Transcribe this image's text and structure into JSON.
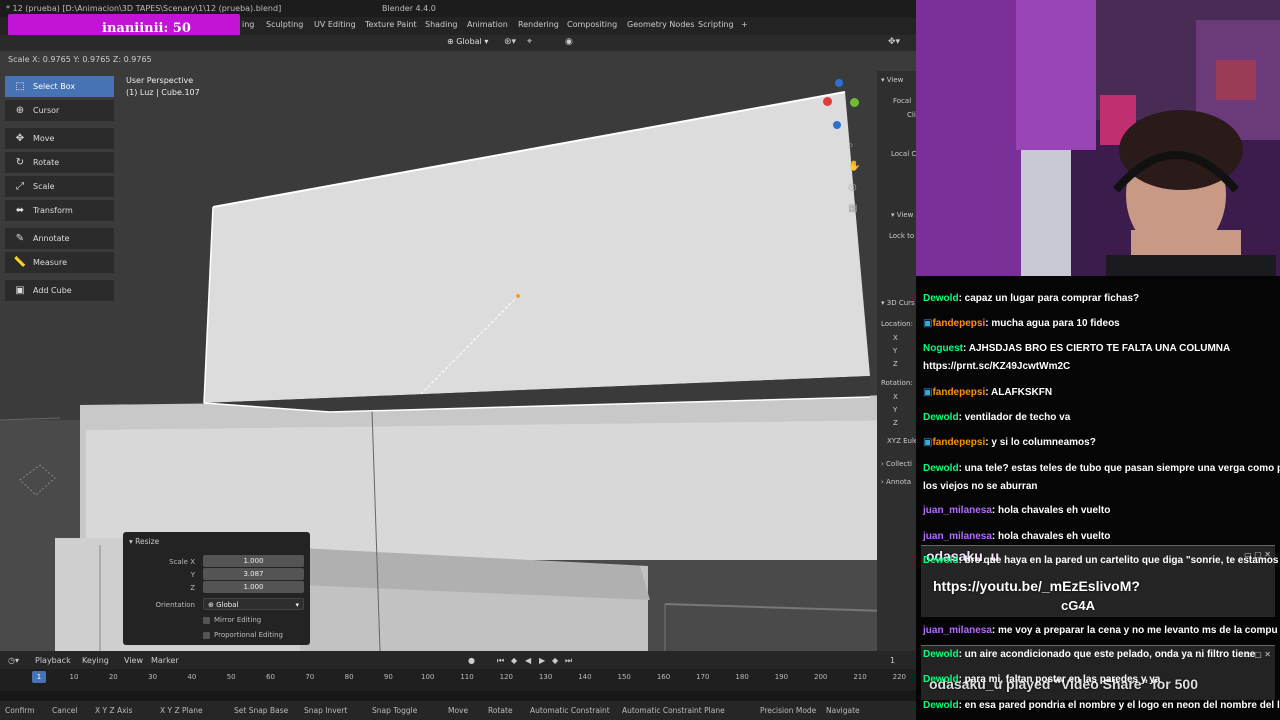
{
  "window": {
    "title": "* 12 (prueba) [D:\\Animacion\\3D TAPES\\Scenary\\1\\12 (prueba).blend]",
    "app_title": "Blender 4.4.0"
  },
  "alert": {
    "text": "inaniinii: 50"
  },
  "workspaces": [
    "ing",
    "Sculpting",
    "UV Editing",
    "Texture Paint",
    "Shading",
    "Animation",
    "Rendering",
    "Compositing",
    "Geometry Nodes",
    "Scripting",
    "+"
  ],
  "header": {
    "orientation": "Global"
  },
  "scale_info": "Scale X: 0.9765   Y: 0.9765   Z: 0.9765",
  "viewport": {
    "perspective": "User Perspective",
    "collection": "(1) Luz  | Cube.107"
  },
  "tools": [
    "Select Box",
    "Cursor",
    "Move",
    "Rotate",
    "Scale",
    "Transform",
    "Annotate",
    "Measure",
    "Add Cube"
  ],
  "resize_panel": {
    "title": "Resize",
    "scale_x_label": "Scale X",
    "scale_x": "1.000",
    "y_label": "Y",
    "y": "3.087",
    "z_label": "Z",
    "z": "1.000",
    "orientation_label": "Orientation",
    "orientation": "Global",
    "mirror_editing": "Mirror Editing",
    "proportional_editing": "Proportional Editing"
  },
  "n_panel": {
    "view": "View",
    "focal": "Focal",
    "clip": "Cli",
    "local": "Local C",
    "view2": "View",
    "lock": "Lock to",
    "cursor": "3D Curs",
    "location": "Location:",
    "x": "X",
    "y": "Y",
    "z": "Z",
    "rotation": "Rotation:",
    "euler": "XYZ Eule",
    "collection": "Collecti",
    "annotations": "Annota"
  },
  "timeline": {
    "menus": [
      "Playback",
      "Keying",
      "View",
      "Marker"
    ],
    "current_frame": "1",
    "frame_field": "1",
    "ticks": [
      "10",
      "20",
      "30",
      "40",
      "50",
      "60",
      "70",
      "80",
      "90",
      "100",
      "110",
      "120",
      "130",
      "140",
      "150",
      "160",
      "170",
      "180",
      "190",
      "200",
      "210",
      "220"
    ]
  },
  "statusbar": [
    "Confirm",
    "Cancel",
    "X Y Z Axis",
    "X Y Z Plane",
    "Set Snap Base",
    "Snap Invert",
    "Snap Toggle",
    "Move",
    "Rotate",
    "Automatic Constraint",
    "Automatic Constraint Plane",
    "Precision Mode",
    "Navigate"
  ],
  "chat": [
    {
      "user": "Dewold",
      "color": "#00ff7f",
      "msg": ": capaz un lugar para comprar fichas?"
    },
    {
      "user": "fandepepsi",
      "color": "#ff9100",
      "msg": ": mucha agua para 10 fideos"
    },
    {
      "user": "Noguest",
      "color": "#00ff7f",
      "msg": ": AJHSDJAS BRO ES CIERTO TE FALTA UNA COLUMNA"
    },
    {
      "user": "",
      "color": "#ffffff",
      "msg": "https://prnt.sc/KZ49JcwtWm2C"
    },
    {
      "user": "fandepepsi",
      "color": "#ff9100",
      "msg": ": ALAFKSKFN"
    },
    {
      "user": "Dewold",
      "color": "#00ff7f",
      "msg": ": ventilador de techo va"
    },
    {
      "user": "fandepepsi",
      "color": "#ff9100",
      "msg": ": y si lo columneamos?"
    },
    {
      "user": "Dewold",
      "color": "#00ff7f",
      "msg": ": una tele? estas teles de tubo que pasan siempre una verga como para que"
    },
    {
      "user": "",
      "color": "#ffffff",
      "msg": "los viejos no se aburran"
    },
    {
      "user": "juan_milanesa",
      "color": "#b36bff",
      "msg": ": hola chavales eh vuelto"
    },
    {
      "user": "juan_milanesa",
      "color": "#b36bff",
      "msg": ": hola chavales eh vuelto"
    },
    {
      "user": "Dewold",
      "color": "#00ff7f",
      "msg": ": bro que haya en la pared un cartelito que diga \"sonrie, te estamos grabando\""
    },
    {
      "user": "juan_milanesa",
      "color": "#b36bff",
      "msg": ": me voy a preparar la cena y no me levanto ms de la compu"
    },
    {
      "user": "Dewold",
      "color": "#00ff7f",
      "msg": ": un aire acondicionado que este pelado, onda ya ni filtro tiene"
    },
    {
      "user": "Dewold",
      "color": "#00ff7f",
      "msg": ": para mi, faltan poster en las paredes y ya"
    },
    {
      "user": "Dewold",
      "color": "#00ff7f",
      "msg": ": en esa pared pondria el nombre y el logo en neon del nombre del local"
    }
  ],
  "popup1": {
    "user": "odasaku_u",
    "url": "https://youtu.be/_mEzEslivoM?",
    "extra": "cG4A"
  },
  "popup2": {
    "user": "odasaku_u",
    "text": "odasaku_u played \"Video Share\" for 500"
  }
}
